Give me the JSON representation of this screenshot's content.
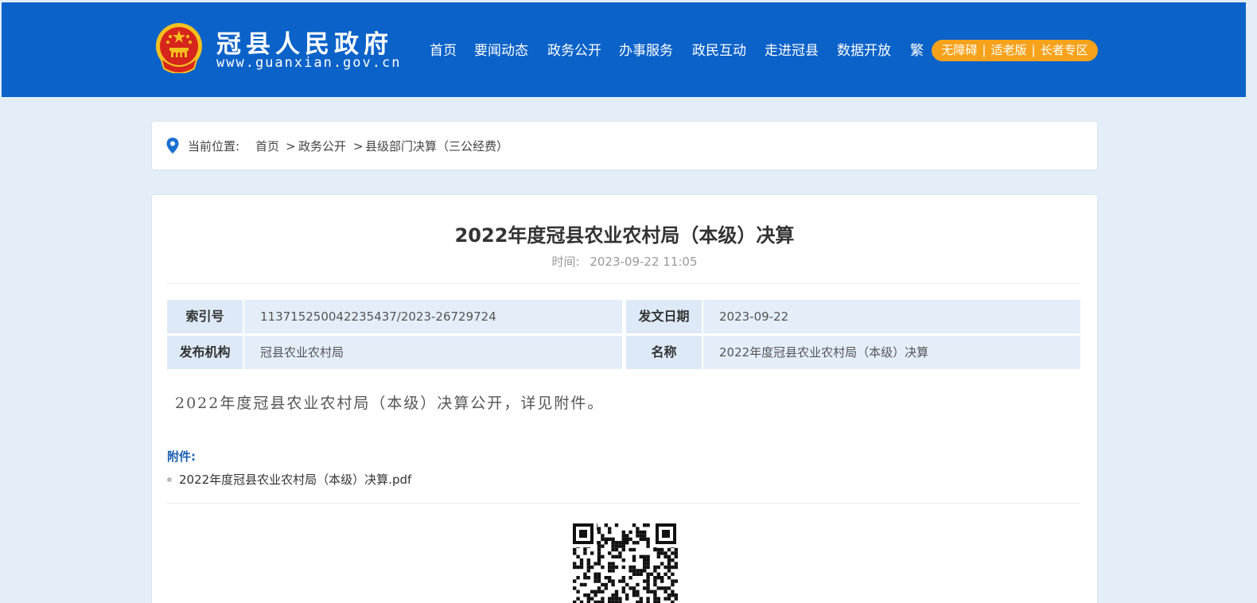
{
  "header": {
    "site_name": "冠县人民政府",
    "site_url": "www.guanxian.gov.cn",
    "nav": [
      {
        "label": "首页"
      },
      {
        "label": "要闻动态"
      },
      {
        "label": "政务公开"
      },
      {
        "label": "办事服务"
      },
      {
        "label": "政民互动"
      },
      {
        "label": "走进冠县"
      },
      {
        "label": "数据开放"
      },
      {
        "label": "繁"
      }
    ],
    "access": {
      "barrier_free": "无障碍",
      "elderly": "适老版",
      "senior_zone": "长者专区",
      "separator": "|"
    },
    "colors": {
      "primary": "#0b62c9",
      "accent": "#f7a21b"
    }
  },
  "breadcrumb": {
    "prefix": "当前位置:",
    "items": [
      "首页",
      "政务公开",
      "县级部门决算（三公经费）"
    ],
    "separator": ">"
  },
  "article": {
    "title": "2022年度冠县农业农村局（本级）决算",
    "time_label": "时间:",
    "time_value": "2023-09-22 11:05",
    "meta": {
      "index_label": "索引号",
      "index_value": "113715250042235437/2023-26729724",
      "date_label": "发文日期",
      "date_value": "2023-09-22",
      "org_label": "发布机构",
      "org_value": "冠县农业农村局",
      "name_label": "名称",
      "name_value": "2022年度冠县农业农村局（本级）决算"
    },
    "body": "2022年度冠县农业农村局（本级）决算公开，详见附件。",
    "attachment_label": "附件:",
    "attachments": [
      "2022年度冠县农业农村局（本级）决算.pdf"
    ]
  }
}
